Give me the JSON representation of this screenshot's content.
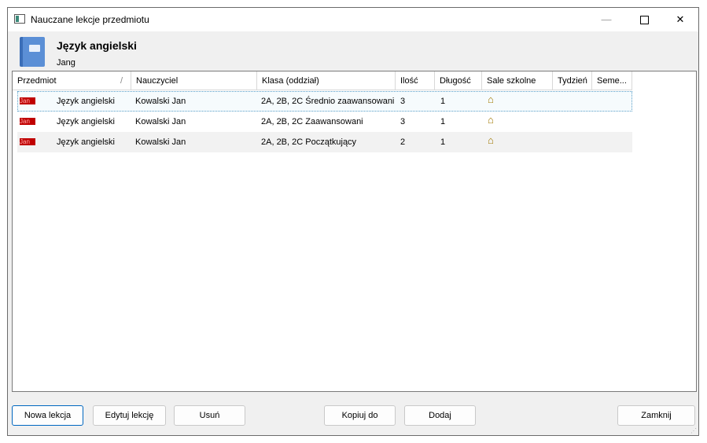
{
  "window": {
    "title": "Nauczane lekcje przedmiotu"
  },
  "header": {
    "subject_name": "Język angielski",
    "short_name": "Jang"
  },
  "grid": {
    "columns": [
      "Przedmiot",
      "Nauczyciel",
      "Klasa (oddział)",
      "Ilość",
      "Długość",
      "Sale szkolne",
      "Tydzień",
      "Seme..."
    ],
    "rows": [
      {
        "badge": "Jan",
        "subject": "Język angielski",
        "teacher": "Kowalski Jan",
        "class": "2A, 2B, 2C Średnio zaawansowani",
        "count": "3",
        "length": "1",
        "rooms_icon": "house-icon"
      },
      {
        "badge": "Jan",
        "subject": "Język angielski",
        "teacher": "Kowalski Jan",
        "class": "2A, 2B, 2C Zaawansowani",
        "count": "3",
        "length": "1",
        "rooms_icon": "house-icon"
      },
      {
        "badge": "Jan",
        "subject": "Język angielski",
        "teacher": "Kowalski Jan",
        "class": "2A, 2B, 2C Początkujący",
        "count": "2",
        "length": "1",
        "rooms_icon": "house-icon"
      }
    ]
  },
  "buttons": {
    "new": "Nowa lekcja",
    "edit": "Edytuj lekcję",
    "delete": "Usuń",
    "copy": "Kopiuj do",
    "add": "Dodaj",
    "close": "Zamknij"
  },
  "colors": {
    "badge": "#c00000",
    "primary_border": "#0067c0",
    "selection_outline": "#5a9fc8"
  }
}
